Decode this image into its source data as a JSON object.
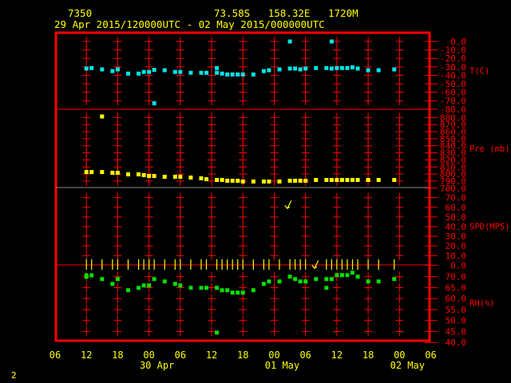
{
  "header": {
    "station": "7350",
    "location": "73.58S   158.32E   1720M",
    "period": "29 Apr 2015/120000UTC - 02 May 2015/000000UTC"
  },
  "footer": {
    "page": "2"
  },
  "colors": {
    "frame": "#ff0000",
    "text": "#ffff00",
    "temp": "#00e5e5",
    "pressure": "#ffff00",
    "wind": "#ffff00",
    "rh": "#00e000"
  },
  "chart_data": {
    "type": "scatter",
    "title": "29 Apr 2015/120000UTC - 02 May 2015/000000UTC",
    "x_unit": "hours since 29 Apr 2015 12UTC",
    "x_ticks": [
      "06",
      "12",
      "18",
      "00",
      "06",
      "12",
      "18",
      "00",
      "06",
      "12",
      "18",
      "00",
      "06"
    ],
    "x_tick_hours": [
      -6,
      0,
      6,
      12,
      18,
      24,
      30,
      36,
      42,
      48,
      54,
      60,
      66
    ],
    "date_labels": [
      {
        "label": "30 Apr",
        "hour": 12
      },
      {
        "label": "01 May",
        "hour": 36
      },
      {
        "label": "02 May",
        "hour": 60
      }
    ],
    "panels": [
      {
        "name": "T(C)",
        "ylim": [
          -80,
          0
        ],
        "ticks": [
          "0.0",
          "-10.0",
          "-20.0",
          "-30.0",
          "-40.0",
          "-50.0",
          "-60.0",
          "-70.0",
          "-80.0"
        ],
        "points": [
          [
            0,
            -32
          ],
          [
            1,
            -31.4
          ],
          [
            3,
            -33
          ],
          [
            5,
            -35
          ],
          [
            6,
            -33
          ],
          [
            8,
            -38
          ],
          [
            10,
            -38
          ],
          [
            11,
            -36
          ],
          [
            12,
            -36
          ],
          [
            13,
            -33.5
          ],
          [
            13,
            -73
          ],
          [
            15,
            -34
          ],
          [
            17,
            -36
          ],
          [
            18,
            -36
          ],
          [
            20,
            -37
          ],
          [
            22,
            -37
          ],
          [
            23,
            -37
          ],
          [
            25,
            -31.4
          ],
          [
            25,
            -37
          ],
          [
            26,
            -38
          ],
          [
            27,
            -39
          ],
          [
            28,
            -39
          ],
          [
            29,
            -39
          ],
          [
            30,
            -39
          ],
          [
            32,
            -39
          ],
          [
            34,
            -35
          ],
          [
            35,
            -34
          ],
          [
            37,
            -33
          ],
          [
            39,
            0
          ],
          [
            39,
            -32
          ],
          [
            40,
            -32
          ],
          [
            41,
            -33
          ],
          [
            42,
            -32
          ],
          [
            44,
            -31.4
          ],
          [
            46,
            -31.4
          ],
          [
            47,
            0
          ],
          [
            47,
            -32
          ],
          [
            48,
            -31.4
          ],
          [
            49,
            -31.4
          ],
          [
            50,
            -31.4
          ],
          [
            51,
            -30.5
          ],
          [
            52,
            -32
          ],
          [
            54,
            -34
          ],
          [
            56,
            -34
          ],
          [
            59,
            -33
          ]
        ]
      },
      {
        "name": "Pre (mb)",
        "ylim": [
          780,
          880
        ],
        "ticks": [
          "880.0",
          "870.0",
          "860.0",
          "850.0",
          "840.0",
          "830.0",
          "820.0",
          "810.0",
          "800.0",
          "790.0",
          "780.0"
        ],
        "points": [
          [
            0,
            802.8
          ],
          [
            1,
            802.8
          ],
          [
            3,
            881.5
          ],
          [
            3,
            802.8
          ],
          [
            5,
            801.7
          ],
          [
            6,
            801.7
          ],
          [
            8,
            799.5
          ],
          [
            10,
            799.5
          ],
          [
            11,
            798.4
          ],
          [
            12,
            797.2
          ],
          [
            13,
            797.2
          ],
          [
            15,
            796.1
          ],
          [
            17,
            796.1
          ],
          [
            18,
            796.1
          ],
          [
            20,
            795
          ],
          [
            22,
            793.9
          ],
          [
            23,
            792.7
          ],
          [
            25,
            791.6
          ],
          [
            26,
            791.6
          ],
          [
            27,
            790.5
          ],
          [
            28,
            790.5
          ],
          [
            29,
            790.5
          ],
          [
            30,
            789.4
          ],
          [
            32,
            789.4
          ],
          [
            34,
            789.4
          ],
          [
            35,
            789.4
          ],
          [
            37,
            789.4
          ],
          [
            39,
            790.5
          ],
          [
            40,
            790.5
          ],
          [
            41,
            790.5
          ],
          [
            42,
            790.5
          ],
          [
            44,
            791.6
          ],
          [
            46,
            791.6
          ],
          [
            47,
            791.6
          ],
          [
            48,
            791.6
          ],
          [
            49,
            791.6
          ],
          [
            50,
            791.6
          ],
          [
            51,
            791.6
          ],
          [
            52,
            791.6
          ],
          [
            54,
            791.6
          ],
          [
            56,
            791.6
          ],
          [
            59,
            791.6
          ]
        ]
      },
      {
        "name": "SPD(MPS)",
        "ylim": [
          0,
          70
        ],
        "ticks": [
          "70.0",
          "60.0",
          "50.0",
          "40.0",
          "30.0",
          "20.0",
          "10.0",
          "0.0"
        ],
        "points": [
          [
            0,
            0
          ],
          [
            1,
            0
          ],
          [
            3,
            0
          ],
          [
            5,
            0
          ],
          [
            6,
            0
          ],
          [
            8,
            0
          ],
          [
            10,
            0
          ],
          [
            11,
            0
          ],
          [
            12,
            0
          ],
          [
            13,
            0
          ],
          [
            15,
            0
          ],
          [
            17,
            0
          ],
          [
            18,
            0
          ],
          [
            20,
            0
          ],
          [
            22,
            0
          ],
          [
            23,
            0
          ],
          [
            25,
            0
          ],
          [
            26,
            0
          ],
          [
            27,
            0
          ],
          [
            28,
            0
          ],
          [
            29,
            0
          ],
          [
            30,
            0
          ],
          [
            32,
            0
          ],
          [
            34,
            0
          ],
          [
            35,
            0
          ],
          [
            37,
            0
          ],
          [
            39,
            0
          ],
          [
            40,
            0
          ],
          [
            41,
            0
          ],
          [
            42,
            0
          ],
          [
            46,
            0
          ],
          [
            47,
            0
          ],
          [
            48,
            0
          ],
          [
            49,
            0
          ],
          [
            50,
            0
          ],
          [
            51,
            0
          ],
          [
            52,
            0
          ],
          [
            54,
            0
          ],
          [
            56,
            0
          ],
          [
            59,
            0
          ]
        ],
        "barbs": [
          [
            38.5,
            62
          ],
          [
            43.7,
            0
          ]
        ]
      },
      {
        "name": "RH(%)",
        "ylim": [
          40,
          70
        ],
        "ticks": [
          "70.0",
          "65.0",
          "60.0",
          "55.0",
          "50.0",
          "45.0",
          "40.0"
        ],
        "points": [
          [
            0,
            70.6
          ],
          [
            0,
            69.9
          ],
          [
            1,
            70.6
          ],
          [
            3,
            68.9
          ],
          [
            5,
            66.7
          ],
          [
            6,
            68.9
          ],
          [
            8,
            63.8
          ],
          [
            10,
            64.9
          ],
          [
            11,
            66
          ],
          [
            12,
            66
          ],
          [
            13,
            68.9
          ],
          [
            15,
            67.8
          ],
          [
            17,
            66.7
          ],
          [
            18,
            66
          ],
          [
            20,
            64.9
          ],
          [
            22,
            64.9
          ],
          [
            23,
            64.9
          ],
          [
            25,
            64.9
          ],
          [
            25,
            44.5
          ],
          [
            26,
            63.8
          ],
          [
            27,
            63.8
          ],
          [
            28,
            62.7
          ],
          [
            29,
            62.7
          ],
          [
            30,
            62.7
          ],
          [
            32,
            63.8
          ],
          [
            34,
            66.7
          ],
          [
            35,
            67.8
          ],
          [
            37,
            67.8
          ],
          [
            39,
            70
          ],
          [
            40,
            68.9
          ],
          [
            41,
            67.8
          ],
          [
            42,
            67.8
          ],
          [
            44,
            68.9
          ],
          [
            46,
            68.9
          ],
          [
            46,
            64.9
          ],
          [
            47,
            68.9
          ],
          [
            48,
            70.7
          ],
          [
            49,
            70.7
          ],
          [
            50,
            70.7
          ],
          [
            51,
            71.8
          ],
          [
            52,
            70
          ],
          [
            54,
            67.8
          ],
          [
            56,
            67.8
          ],
          [
            59,
            68.9
          ]
        ]
      }
    ]
  }
}
